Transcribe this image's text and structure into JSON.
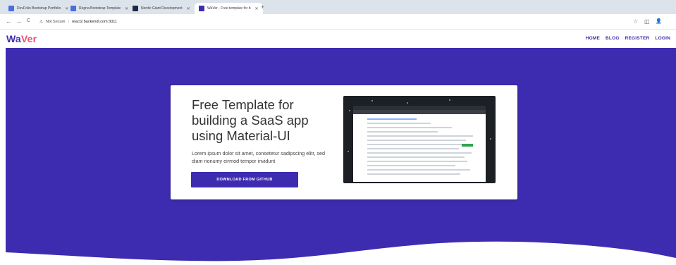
{
  "browser": {
    "tabs": [
      {
        "title": "DevFolio Bootstrap Portfolio",
        "fav_color": "#4a6ee0"
      },
      {
        "title": "Regna Bootstrap Template",
        "fav_color": "#4a6ee0"
      },
      {
        "title": "Nordic Giant Development",
        "fav_color": "#1c2b44"
      },
      {
        "title": "WaVer - Free template for b",
        "fav_color": "#3e2cb0"
      }
    ],
    "new_tab_label": "+",
    "security_label": "Not Secure",
    "url": "react2.backendl.com:3011",
    "back_icon": "←",
    "forward_icon": "→",
    "reload_icon": "C",
    "warning_icon": "⚠",
    "star_icon": "☆",
    "extensions_icon": "◫",
    "profile_icon": "👤"
  },
  "header": {
    "logo_part1": "Wa",
    "logo_part2": "Ver",
    "nav": [
      "HOME",
      "BLOG",
      "REGISTER",
      "LOGIN"
    ]
  },
  "hero": {
    "headline": "Free Template for building a SaaS app using Material-UI",
    "subtext": "Lorem ipsum dolor sit amet, consetetur sadipscing elitr, sed diam nonumy eirmod tempor invidunt",
    "cta_label": "DOWNLOAD FROM GITHUB"
  },
  "colors": {
    "primary": "#3e2cb0",
    "accent": "#e94e77"
  }
}
